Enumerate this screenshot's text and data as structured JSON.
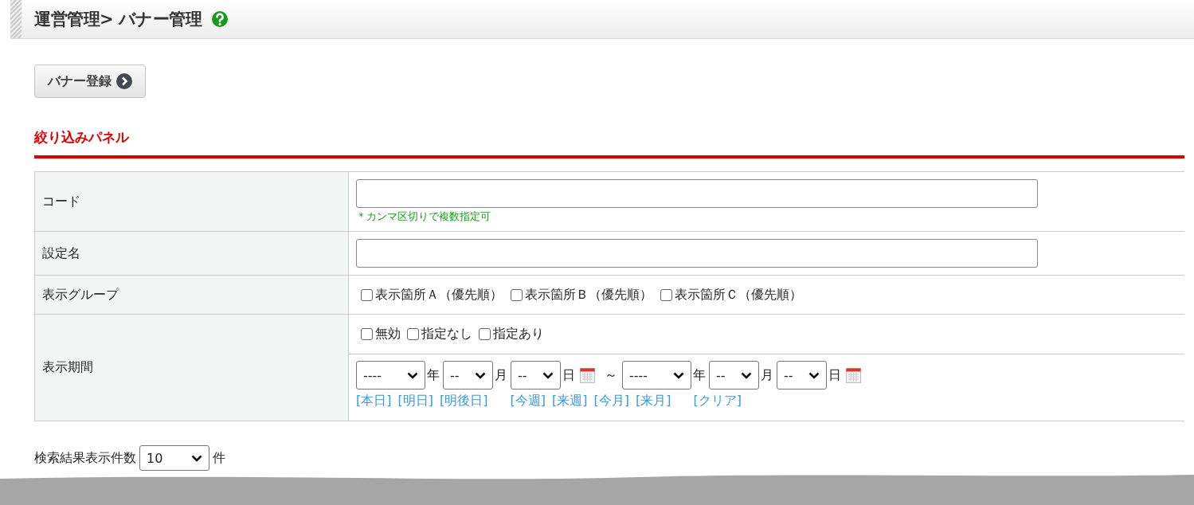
{
  "header": {
    "title": "運営管理> バナー管理"
  },
  "register_button": {
    "label": "バナー登録"
  },
  "filter_panel": {
    "title": "絞り込みパネル",
    "rows": [
      {
        "kind": "text",
        "label": "コード",
        "note": "＊カンマ区切りで複数指定可"
      },
      {
        "kind": "text",
        "label": "設定名"
      },
      {
        "kind": "checks",
        "label": "表示グループ",
        "options": [
          {
            "label": "表示箇所Ａ（優先順）",
            "checked": false
          },
          {
            "label": "表示箇所Ｂ（優先順）",
            "checked": false
          },
          {
            "label": "表示箇所Ｃ（優先順）",
            "checked": false
          }
        ]
      },
      {
        "kind": "period",
        "label": "表示期間",
        "options": [
          {
            "label": "無効",
            "checked": false
          },
          {
            "label": "指定なし",
            "checked": false
          },
          {
            "label": "指定あり",
            "checked": false
          }
        ],
        "from": [
          {
            "value": "----",
            "unit": "年"
          },
          {
            "value": "--",
            "unit": "月"
          },
          {
            "value": "--",
            "unit": "日"
          }
        ],
        "separator": "～",
        "to": [
          {
            "value": "----",
            "unit": "年"
          },
          {
            "value": "--",
            "unit": "月"
          },
          {
            "value": "--",
            "unit": "日"
          }
        ],
        "shortcut_groups": [
          [
            "[本日]",
            "[明日]",
            "[明後日]"
          ],
          [
            "[今週]",
            "[来週]",
            "[今月]",
            "[来月]"
          ],
          [
            "[クリア]"
          ]
        ]
      }
    ]
  },
  "results_per_page": {
    "label": "検索結果表示件数",
    "value": "10",
    "unit": "件"
  }
}
